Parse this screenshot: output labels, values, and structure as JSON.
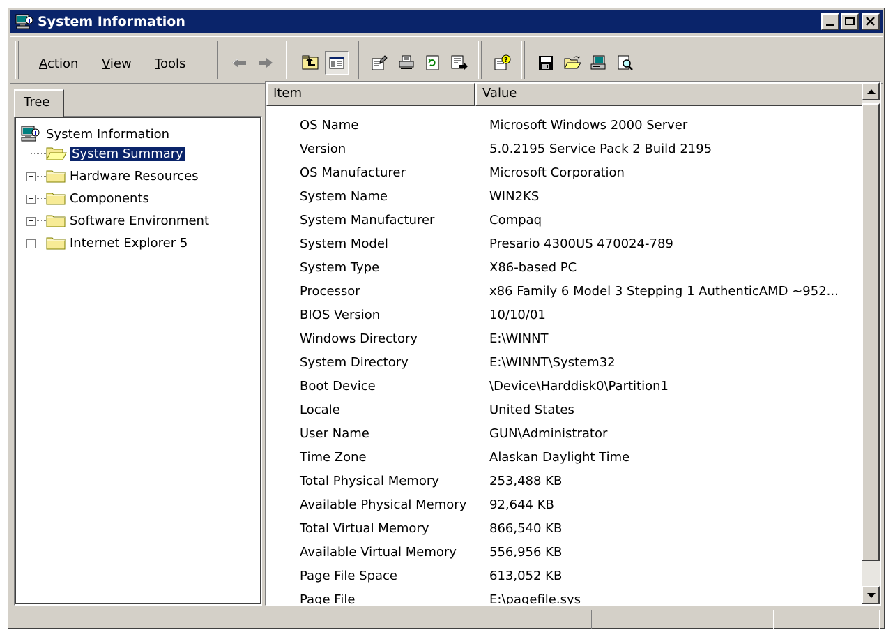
{
  "window": {
    "title": "System Information",
    "colors": {
      "titlebar": "#0a246a",
      "face": "#d4d0c8",
      "selection": "#0a246a"
    }
  },
  "menu": {
    "action": "Action",
    "view": "View",
    "tools": "Tools"
  },
  "toolbar_icons": [
    "back-arrow-icon",
    "forward-arrow-icon",
    "up-level-icon",
    "show-hide-tree-icon",
    "properties-icon",
    "print-icon",
    "refresh-icon",
    "export-list-icon",
    "help-icon",
    "save-icon",
    "open-icon",
    "system-info-icon",
    "find-icon"
  ],
  "tree": {
    "tab_label": "Tree",
    "root": "System Information",
    "items": [
      {
        "label": "System Summary",
        "selected": true
      },
      {
        "label": "Hardware Resources",
        "expander": "+"
      },
      {
        "label": "Components",
        "expander": "+"
      },
      {
        "label": "Software Environment",
        "expander": "+"
      },
      {
        "label": "Internet Explorer 5",
        "expander": "+"
      }
    ]
  },
  "list": {
    "headers": {
      "item": "Item",
      "value": "Value"
    },
    "rows": [
      {
        "item": "OS Name",
        "value": "Microsoft Windows 2000 Server"
      },
      {
        "item": "Version",
        "value": "5.0.2195 Service Pack 2 Build 2195"
      },
      {
        "item": "OS Manufacturer",
        "value": "Microsoft Corporation"
      },
      {
        "item": "System Name",
        "value": "WIN2KS"
      },
      {
        "item": "System Manufacturer",
        "value": "Compaq"
      },
      {
        "item": "System Model",
        "value": "Presario 4300US 470024-789"
      },
      {
        "item": "System Type",
        "value": "X86-based PC"
      },
      {
        "item": "Processor",
        "value": "x86 Family 6 Model 3 Stepping 1 AuthenticAMD ~952..."
      },
      {
        "item": "BIOS Version",
        "value": "10/10/01"
      },
      {
        "item": "Windows Directory",
        "value": "E:\\WINNT"
      },
      {
        "item": "System Directory",
        "value": "E:\\WINNT\\System32"
      },
      {
        "item": "Boot Device",
        "value": "\\Device\\Harddisk0\\Partition1"
      },
      {
        "item": "Locale",
        "value": "United States"
      },
      {
        "item": "User Name",
        "value": "GUN\\Administrator"
      },
      {
        "item": "Time Zone",
        "value": "Alaskan Daylight Time"
      },
      {
        "item": "Total Physical Memory",
        "value": "253,488 KB"
      },
      {
        "item": "Available Physical Memory",
        "value": "92,644 KB"
      },
      {
        "item": "Total Virtual Memory",
        "value": "866,540 KB"
      },
      {
        "item": "Available Virtual Memory",
        "value": "556,956 KB"
      },
      {
        "item": "Page File Space",
        "value": "613,052 KB"
      },
      {
        "item": "Page File",
        "value": "E:\\pagefile.sys"
      }
    ]
  },
  "statusbar": {
    "panels": [
      "",
      "",
      ""
    ]
  }
}
